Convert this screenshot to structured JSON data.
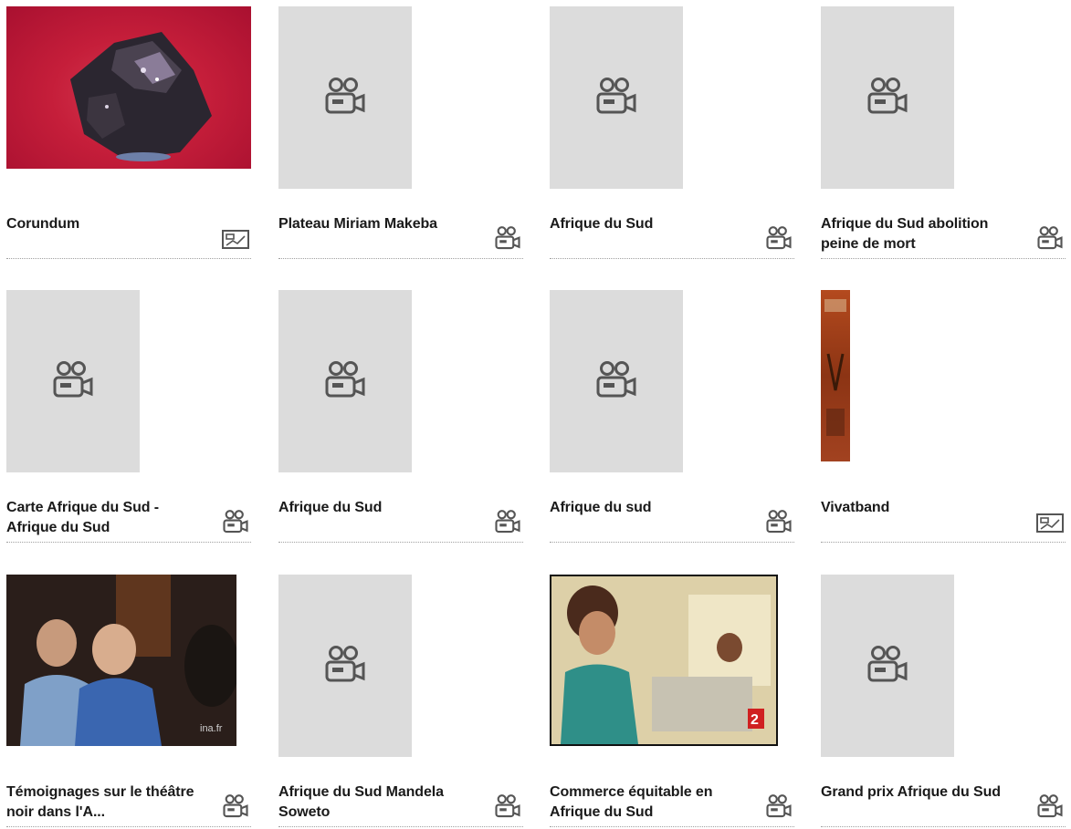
{
  "items": [
    {
      "title": "Corundum",
      "type": "image",
      "thumbnail": "photo"
    },
    {
      "title": "Plateau Miriam Makeba",
      "type": "video",
      "thumbnail": "placeholder"
    },
    {
      "title": "Afrique du Sud",
      "type": "video",
      "thumbnail": "placeholder"
    },
    {
      "title": "Afrique du Sud abolition peine de mort",
      "type": "video",
      "thumbnail": "placeholder"
    },
    {
      "title": "Carte Afrique du Sud - Afrique du Sud",
      "type": "video",
      "thumbnail": "placeholder"
    },
    {
      "title": "Afrique du Sud",
      "type": "video",
      "thumbnail": "placeholder"
    },
    {
      "title": "Afrique du sud",
      "type": "video",
      "thumbnail": "placeholder"
    },
    {
      "title": "Vivatband",
      "type": "image",
      "thumbnail": "photo"
    },
    {
      "title": "Témoignages sur le théâtre noir dans l'A...",
      "type": "video",
      "thumbnail": "photo"
    },
    {
      "title": "Afrique du Sud Mandela Soweto",
      "type": "video",
      "thumbnail": "placeholder"
    },
    {
      "title": "Commerce équitable en Afrique du Sud",
      "type": "video",
      "thumbnail": "photo"
    },
    {
      "title": "Grand prix Afrique du Sud",
      "type": "video",
      "thumbnail": "placeholder"
    }
  ],
  "icons": {
    "video": "video-camera-icon",
    "image": "image-icon"
  },
  "colors": {
    "placeholder_bg": "#dcdcdc",
    "icon_stroke": "#555555",
    "title_text": "#1a1a1a",
    "divider": "#a0a0a0"
  }
}
